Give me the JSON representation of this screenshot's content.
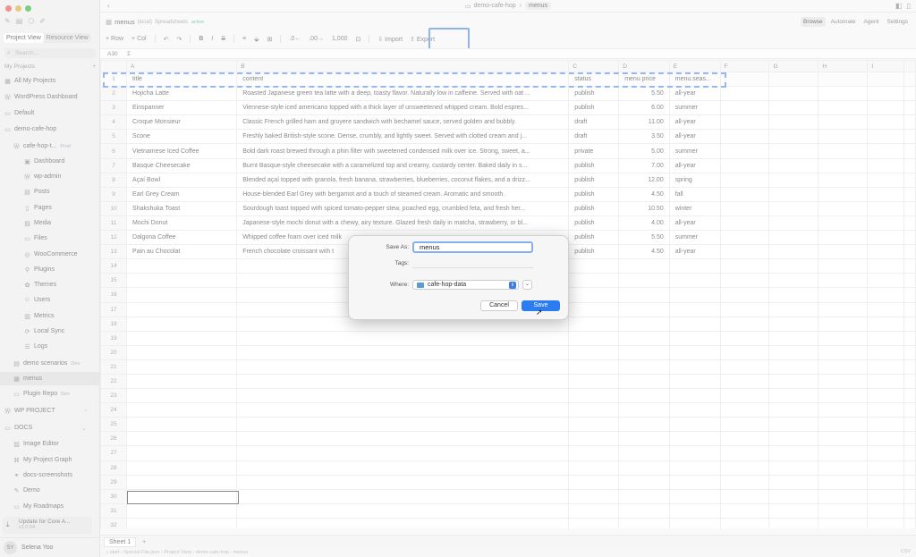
{
  "sidebar": {
    "view_tabs": [
      "Project View",
      "Resource View"
    ],
    "search_placeholder": "Search...",
    "section_my_projects": "My Projects",
    "items": [
      {
        "label": "All My Projects",
        "icon": "grid-icon"
      },
      {
        "label": "WordPress Dashboard",
        "icon": "wordpress-icon"
      },
      {
        "label": "Default",
        "icon": "folder-icon"
      },
      {
        "label": "demo-cafe-hop",
        "icon": "folder-icon"
      },
      {
        "label": "cafe-hop-t...",
        "tag": "Prod",
        "icon": "wordpress-icon"
      },
      {
        "label": "Dashboard",
        "icon": "dashboard-icon"
      },
      {
        "label": "wp-admin",
        "icon": "wp-icon"
      },
      {
        "label": "Posts",
        "icon": "posts-icon"
      },
      {
        "label": "Pages",
        "icon": "pages-icon"
      },
      {
        "label": "Media",
        "icon": "media-icon"
      },
      {
        "label": "Files",
        "icon": "files-icon"
      },
      {
        "label": "WooCommerce",
        "icon": "woo-icon"
      },
      {
        "label": "Plugins",
        "icon": "plugin-icon"
      },
      {
        "label": "Themes",
        "icon": "themes-icon"
      },
      {
        "label": "Users",
        "icon": "users-icon"
      },
      {
        "label": "Metrics",
        "icon": "metrics-icon"
      },
      {
        "label": "Local Sync",
        "icon": "sync-icon"
      },
      {
        "label": "Logs",
        "icon": "logs-icon"
      },
      {
        "label": "demo scenarios",
        "tag": "Dev",
        "icon": "doc-icon"
      },
      {
        "label": "menus",
        "icon": "sheet-icon"
      },
      {
        "label": "Plugin Repo",
        "tag": "Dev",
        "icon": "repo-icon"
      },
      {
        "label": "WP PROJECT",
        "icon": "wp-icon"
      },
      {
        "label": "DOCS",
        "icon": "docs-icon"
      },
      {
        "label": "Image Editor",
        "icon": "image-icon"
      },
      {
        "label": "My Project Graph",
        "icon": "graph-icon"
      },
      {
        "label": "docs-screenshots",
        "icon": "link-icon"
      },
      {
        "label": "Demo",
        "icon": "demo-icon"
      },
      {
        "label": "My Roadmaps",
        "icon": "roadmap-icon"
      }
    ],
    "update": {
      "title": "Update for Core A...",
      "version": "v1.0.54"
    },
    "user": {
      "initials": "SY",
      "name": "Selena Yoo"
    }
  },
  "topbar": {
    "crumb_project": "demo-cafe-hop",
    "crumb_current": "menus"
  },
  "titlebar": {
    "doc": "menus",
    "sub1": "(local)",
    "sub2": "Spreadsheets",
    "badge": "active",
    "modes": [
      "Browse",
      "Automate",
      "Agent",
      "Settings"
    ]
  },
  "toolbar": {
    "row": "+ Row",
    "col": "+ Col",
    "undo": "↶",
    "redo": "↷",
    "bold": "B",
    "italic": "I",
    "strike": "S",
    "align": "≡",
    "fill": "⬙",
    "border": "⊞",
    "dec_less": ".0←",
    "dec_more": ".00→",
    "number": "1,000",
    "format": "⊡",
    "import": "⇩ Import",
    "export": "⇧ Export"
  },
  "formula": {
    "ref": "A30",
    "fx": "Σ"
  },
  "grid": {
    "columns": [
      "A",
      "B",
      "C",
      "D",
      "E",
      "F",
      "G",
      "H",
      "I"
    ],
    "header_row": [
      "title",
      "content",
      "status",
      "menu price",
      "menu.seas..."
    ],
    "rows": [
      [
        "Hojicha Latte",
        "Roasted Japanese green tea latte with a deep, toasty flavor. Naturally low in caffeine. Served with oat ...",
        "publish",
        "5.50",
        "all-year"
      ],
      [
        "Einspanner",
        "Viennese-style iced americano topped with a thick layer of unsweetened whipped cream. Bold espres...",
        "publish",
        "6.00",
        "summer"
      ],
      [
        "Croque Monsieur",
        "Classic French grilled ham and gruyere sandwich with bechamel sauce, served golden and bubbly.",
        "draft",
        "11.00",
        "all-year"
      ],
      [
        "Scone",
        "Freshly baked British-style scone. Dense, crumbly, and lightly sweet. Served with clotted cream and j...",
        "draft",
        "3.50",
        "all-year"
      ],
      [
        "Vietnamese Iced Coffee",
        "Bold dark roast brewed through a phin filter with sweetened condensed milk over ice. Strong, sweet, a...",
        "private",
        "5.00",
        "summer"
      ],
      [
        "Basque Cheesecake",
        "Burnt Basque-style cheesecake with a caramelized top and creamy, custardy center. Baked daily in s...",
        "publish",
        "7.00",
        "all-year"
      ],
      [
        "Açaí Bowl",
        "Blended açaí topped with granola, fresh banana, strawberries, blueberries, coconut flakes, and a drizz...",
        "publish",
        "12.00",
        "spring"
      ],
      [
        "Earl Grey Cream",
        "House-blended Earl Grey with bergamot and a touch of steamed cream. Aromatic and smooth.",
        "publish",
        "4.50",
        "fall"
      ],
      [
        "Shakshuka Toast",
        "Sourdough toast topped with spiced tomato-pepper stew, poached egg, crumbled feta, and fresh her...",
        "publish",
        "10.50",
        "winter"
      ],
      [
        "Mochi Donut",
        "Japanese-style mochi donut with a chewy, airy texture. Glazed fresh daily in matcha, strawberry, or bl...",
        "publish",
        "4.00",
        "all-year"
      ],
      [
        "Dalgona Coffee",
        "Whipped coffee foam over iced milk",
        "publish",
        "5.50",
        "summer"
      ],
      [
        "Pain au Chocolat",
        "French chocolate croissant with t",
        "publish",
        "4.50",
        "all-year"
      ]
    ],
    "empty_row_count": 19
  },
  "sheetbar": {
    "tab": "Sheet 1",
    "add": "+"
  },
  "statusbar": {
    "left": "⌂ start  ›  Special File.json  ›  Project View  ›  demo-cafe-hop  ›  menus",
    "right": "CSV"
  },
  "dialog": {
    "save_as_label": "Save As:",
    "save_as_value": "menus",
    "tags_label": "Tags:",
    "where_label": "Where:",
    "where_value": "cafe-hop-data",
    "cancel": "Cancel",
    "save": "Save"
  },
  "colors": {
    "accent": "#2b7cf0",
    "highlight": "#3b7ce6"
  }
}
